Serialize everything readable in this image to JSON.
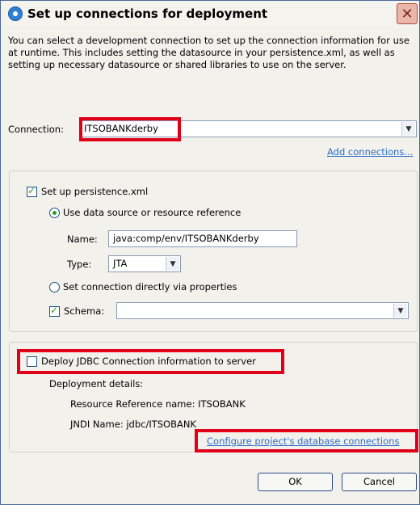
{
  "window": {
    "title": "Set up connections for deployment"
  },
  "description": "You can select a development connection to set up the connection information for use at runtime.  This includes setting the datasource in your persistence.xml, as well as setting up necessary datasource or shared libraries to use on the server.",
  "connection": {
    "label": "Connection:",
    "value": "ITSOBANKderby",
    "add_link": "Add connections..."
  },
  "persistence": {
    "checkbox_label": "Set up persistence.xml",
    "checked": true,
    "radio_datasource_label": "Use data source or resource reference",
    "name_label": "Name:",
    "name_value": "java:comp/env/ITSOBANKderby",
    "type_label": "Type:",
    "type_value": "JTA",
    "radio_direct_label": "Set connection directly via properties",
    "schema_label": "Schema:",
    "schema_checked": true,
    "schema_value": ""
  },
  "deploy": {
    "checkbox_label": "Deploy JDBC Connection information to server",
    "checked": false,
    "details_label": "Deployment details:",
    "resource_ref": "Resource Reference name: ITSOBANK",
    "jndi": "JNDI Name: jdbc/ITSOBANK",
    "configure_link": "Configure project's database connections"
  },
  "buttons": {
    "ok": "OK",
    "cancel": "Cancel"
  },
  "colors": {
    "highlight": "#e0001a",
    "link": "#2d6ec8",
    "check": "#21a121"
  }
}
